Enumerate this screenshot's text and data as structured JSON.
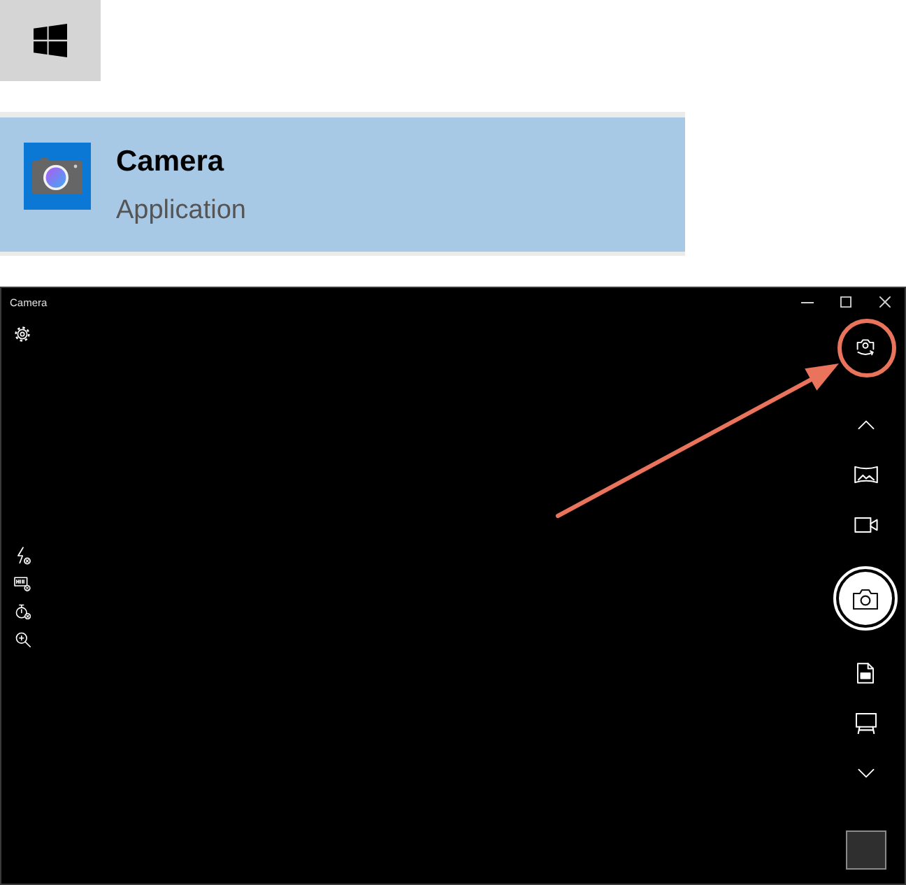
{
  "search_result": {
    "title": "Camera",
    "subtitle": "Application",
    "selected": true
  },
  "window": {
    "title": "Camera",
    "modes": [
      {
        "kind": "panorama",
        "selected": false
      },
      {
        "kind": "video",
        "selected": false
      },
      {
        "kind": "photo",
        "selected": true
      },
      {
        "kind": "document",
        "selected": false
      },
      {
        "kind": "whiteboard",
        "selected": false
      }
    ]
  }
}
